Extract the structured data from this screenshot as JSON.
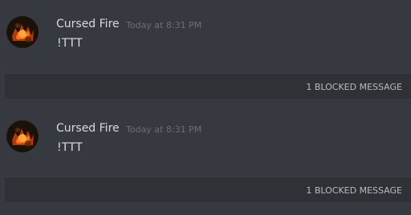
{
  "messages": [
    {
      "username": "Cursed Fire",
      "timestamp": "Today at 8:31 PM",
      "content": "!TTT",
      "avatar_icon": "fire-avatar-icon",
      "blocked_label": "1 BLOCKED MESSAGE"
    },
    {
      "username": "Cursed Fire",
      "timestamp": "Today at 8:31 PM",
      "content": "!TTT",
      "avatar_icon": "fire-avatar-icon",
      "blocked_label": "1 BLOCKED MESSAGE"
    }
  ],
  "colors": {
    "background": "#36393f",
    "blocked_bar": "#2f3136",
    "username": "#d9dadc",
    "timestamp": "#6b6f75",
    "content": "#dcddde",
    "blocked_text": "#b9bbbe"
  }
}
